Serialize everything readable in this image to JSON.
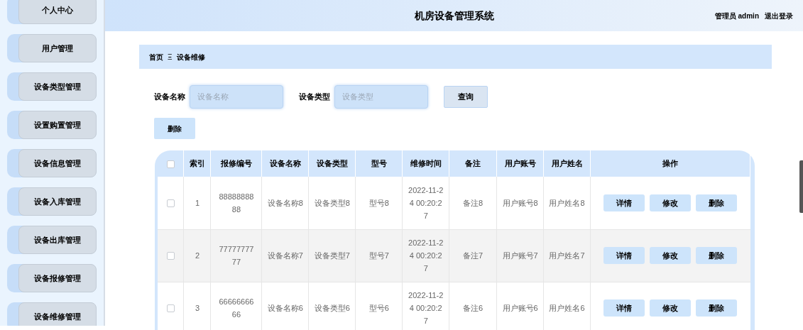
{
  "sidebar": {
    "items": [
      {
        "label": "个人中心",
        "selected": false
      },
      {
        "label": "用户管理",
        "selected": false
      },
      {
        "label": "设备类型管理",
        "selected": false
      },
      {
        "label": "设置购置管理",
        "selected": false
      },
      {
        "label": "设备信息管理",
        "selected": false
      },
      {
        "label": "设备入库管理",
        "selected": false
      },
      {
        "label": "设备出库管理",
        "selected": false
      },
      {
        "label": "设备报修管理",
        "selected": false
      },
      {
        "label": "设备维修管理",
        "selected": false
      }
    ]
  },
  "header": {
    "title": "机房设备管理系统",
    "user": "管理员 admin",
    "logout": "退出登录"
  },
  "breadcrumb": {
    "home": "首页",
    "separator": "Ξ",
    "current": "设备维修"
  },
  "search": {
    "fields": [
      {
        "label": "设备名称",
        "placeholder": "设备名称"
      },
      {
        "label": "设备类型",
        "placeholder": "设备类型"
      }
    ],
    "button": "查询"
  },
  "delete_button": "删除",
  "table": {
    "select_all": {
      "checked": false
    },
    "columns": [
      "索引",
      "报修编号",
      "设备名称",
      "设备类型",
      "型号",
      "维修时间",
      "备注",
      "用户账号",
      "用户姓名",
      "操作"
    ],
    "rows": [
      {
        "checked": false,
        "cells": [
          "1",
          "8888888888",
          "设备名称8",
          "设备类型8",
          "型号8",
          "2022-11-24 00:20:27",
          "备注8",
          "用户账号8",
          "用户姓名8"
        ],
        "actions": [
          "详情",
          "修改",
          "删除"
        ]
      },
      {
        "checked": false,
        "cells": [
          "2",
          "7777777777",
          "设备名称7",
          "设备类型7",
          "型号7",
          "2022-11-24 00:20:27",
          "备注7",
          "用户账号7",
          "用户姓名7"
        ],
        "actions": [
          "详情",
          "修改",
          "删除"
        ]
      },
      {
        "checked": false,
        "cells": [
          "3",
          "6666666666",
          "设备名称6",
          "设备类型6",
          "型号6",
          "2022-11-24 00:20:27",
          "备注6",
          "用户账号6",
          "用户姓名6"
        ],
        "actions": [
          "详情",
          "修改",
          "删除"
        ]
      }
    ]
  }
}
